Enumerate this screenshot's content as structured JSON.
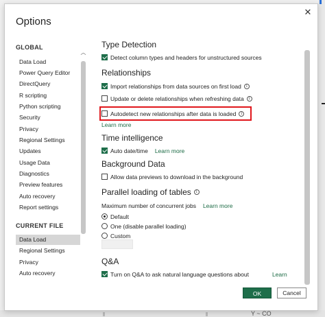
{
  "dialog": {
    "title": "Options",
    "close_glyph": "✕"
  },
  "sidebar": {
    "global_header": "GLOBAL",
    "global_items": [
      {
        "label": "Data Load"
      },
      {
        "label": "Power Query Editor"
      },
      {
        "label": "DirectQuery"
      },
      {
        "label": "R scripting"
      },
      {
        "label": "Python scripting"
      },
      {
        "label": "Security"
      },
      {
        "label": "Privacy"
      },
      {
        "label": "Regional Settings"
      },
      {
        "label": "Updates"
      },
      {
        "label": "Usage Data"
      },
      {
        "label": "Diagnostics"
      },
      {
        "label": "Preview features"
      },
      {
        "label": "Auto recovery"
      },
      {
        "label": "Report settings"
      }
    ],
    "current_header": "CURRENT FILE",
    "current_items": [
      {
        "label": "Data Load",
        "selected": true
      },
      {
        "label": "Regional Settings"
      },
      {
        "label": "Privacy"
      },
      {
        "label": "Auto recovery"
      }
    ]
  },
  "content": {
    "type_detection": {
      "title": "Type Detection",
      "detect_label": "Detect column types and headers for unstructured sources",
      "detect_checked": true
    },
    "relationships": {
      "title": "Relationships",
      "import_label": "Import relationships from data sources on first load",
      "import_checked": true,
      "update_label": "Update or delete relationships when refreshing data",
      "update_checked": false,
      "autodetect_label": "Autodetect new relationships after data is loaded",
      "autodetect_checked": false,
      "learn_more": "Learn more"
    },
    "time_intelligence": {
      "title": "Time intelligence",
      "auto_label": "Auto date/time",
      "auto_checked": true,
      "learn_more": "Learn more"
    },
    "background_data": {
      "title": "Background Data",
      "allow_label": "Allow data previews to download in the background",
      "allow_checked": false
    },
    "parallel": {
      "title": "Parallel loading of tables",
      "max_label": "Maximum number of concurrent jobs",
      "learn_more": "Learn more",
      "options": [
        {
          "label": "Default",
          "selected": true
        },
        {
          "label": "One (disable parallel loading)",
          "selected": false
        },
        {
          "label": "Custom",
          "selected": false
        }
      ]
    },
    "qa": {
      "title": "Q&A",
      "turn_on_label": "Turn on Q&A to ask natural language questions about",
      "turn_on_checked": true,
      "learn_more": "Learn"
    }
  },
  "buttons": {
    "ok": "OK",
    "cancel": "Cancel"
  },
  "background": {
    "bottom_text": "Y  ~  CO"
  },
  "icons": {
    "info": "info-icon",
    "scroll_up": "chevron-up-icon",
    "close": "close-icon"
  },
  "colors": {
    "accent": "#1e6e4a",
    "link": "#1c6b45",
    "highlight": "#e0161b"
  }
}
